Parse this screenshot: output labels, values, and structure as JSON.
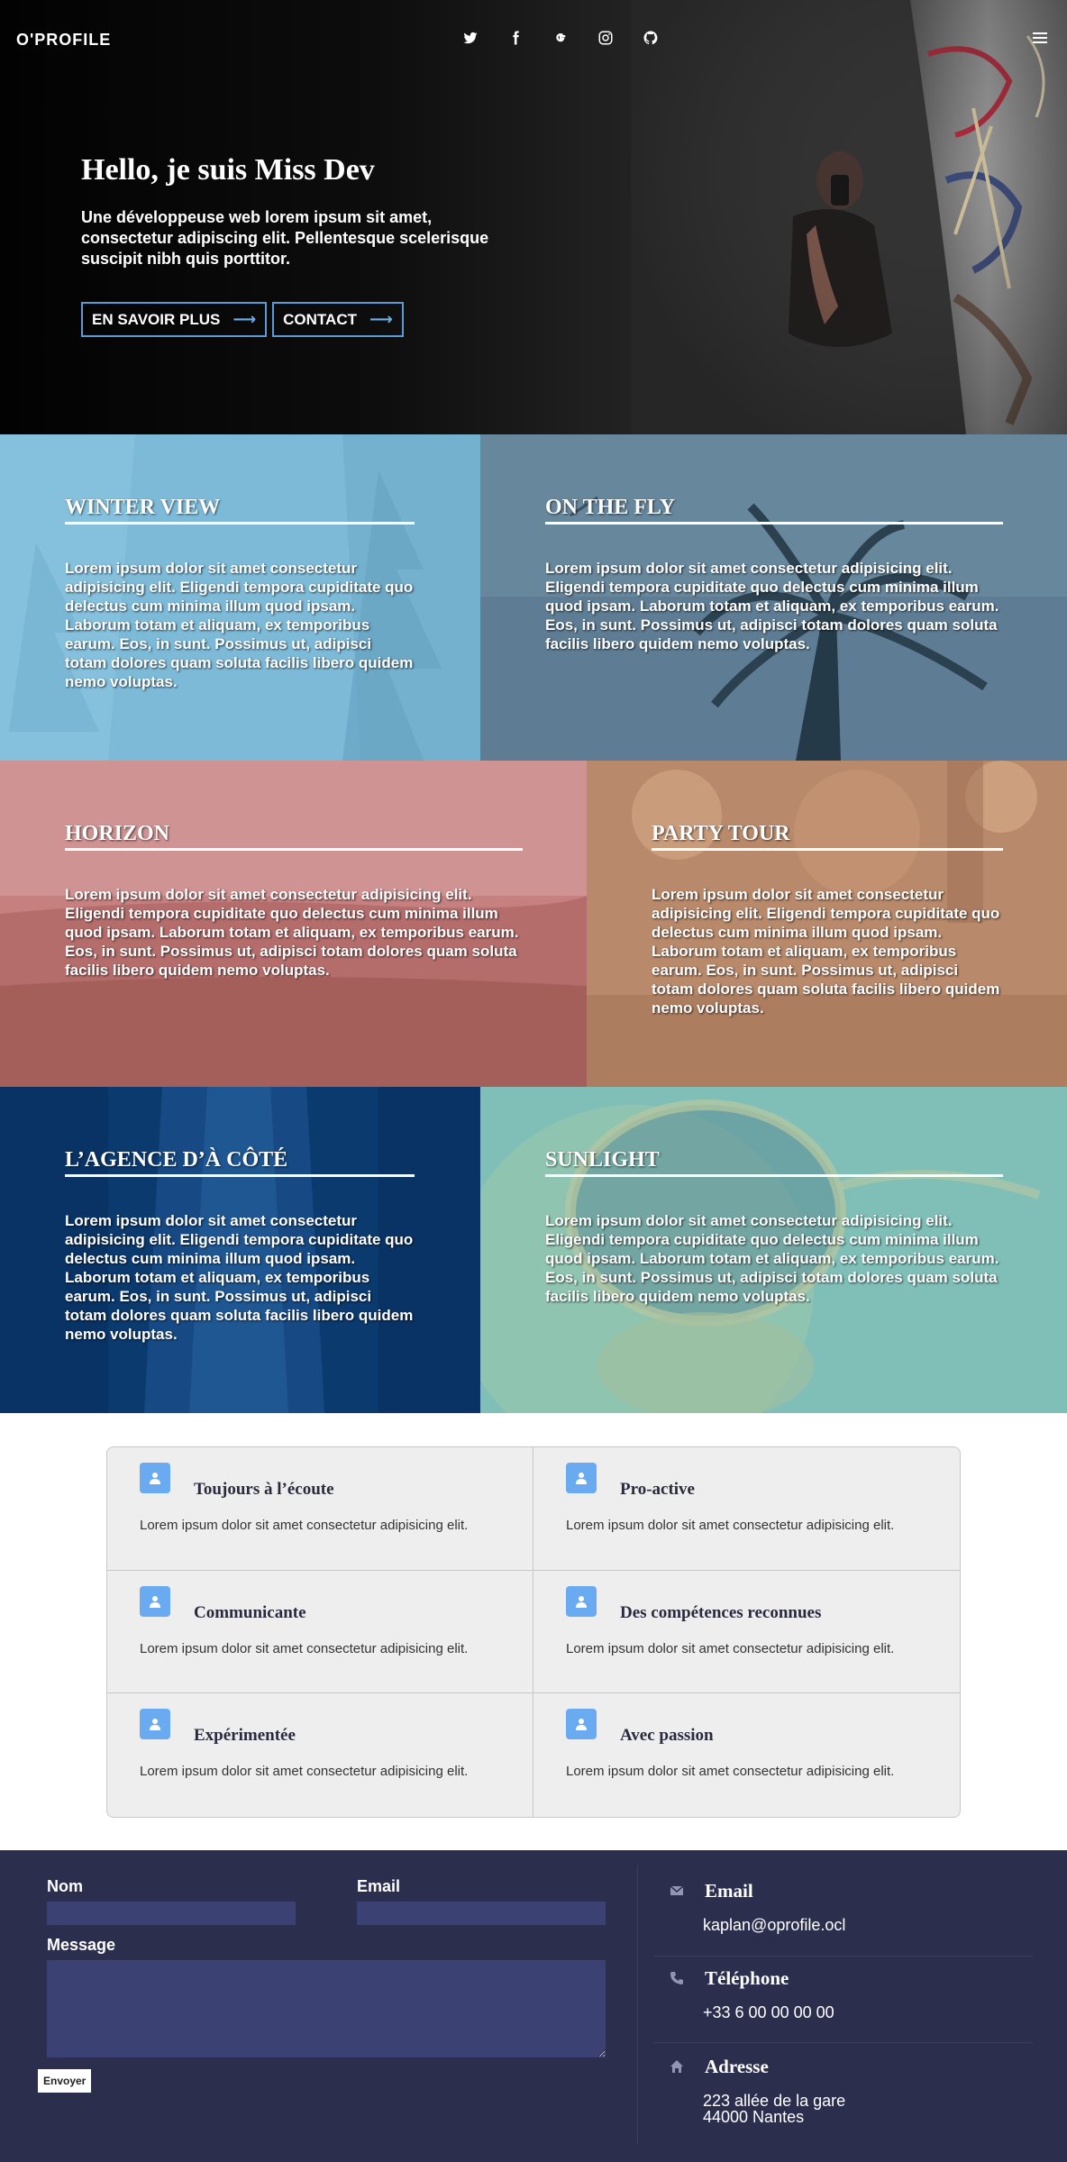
{
  "header": {
    "brand": "O'PROFILE",
    "social_icons": [
      "twitter-icon",
      "facebook-icon",
      "google-icon",
      "instagram-icon",
      "github-icon"
    ],
    "menu_icon": "hamburger-menu-icon"
  },
  "hero": {
    "title": "Hello, je suis Miss Dev",
    "text": "Une développeuse web lorem ipsum sit amet, consectetur adipiscing elit. Pellentesque scelerisque suscipit nibh quis porttitor.",
    "buttons": [
      {
        "label": "EN SAVOIR PLUS",
        "icon": "arrow-right-icon"
      },
      {
        "label": "CONTACT",
        "icon": "arrow-right-icon"
      }
    ]
  },
  "tiles": [
    {
      "title": "WINTER VIEW",
      "text": "Lorem ipsum dolor sit amet consectetur adipisicing elit. Eligendi tempora cupiditate quo delectus cum minima illum quod ipsam. Laborum totam et aliquam, ex temporibus earum. Eos, in sunt. Possimus ut, adipisci totam dolores quam soluta facilis libero quidem nemo voluptas."
    },
    {
      "title": "ON THE FLY",
      "text": "Lorem ipsum dolor sit amet consectetur adipisicing elit. Eligendi tempora cupiditate quo delectus cum minima illum quod ipsam. Laborum totam et aliquam, ex temporibus earum. Eos, in sunt. Possimus ut, adipisci totam dolores quam soluta facilis libero quidem nemo voluptas."
    },
    {
      "title": "HORIZON",
      "text": "Lorem ipsum dolor sit amet consectetur adipisicing elit. Eligendi tempora cupiditate quo delectus cum minima illum quod ipsam. Laborum totam et aliquam, ex temporibus earum. Eos, in sunt. Possimus ut, adipisci totam dolores quam soluta facilis libero quidem nemo voluptas."
    },
    {
      "title": "PARTY TOUR",
      "text": "Lorem ipsum dolor sit amet consectetur adipisicing elit. Eligendi tempora cupiditate quo delectus cum minima illum quod ipsam. Laborum totam et aliquam, ex temporibus earum. Eos, in sunt. Possimus ut, adipisci totam dolores quam soluta facilis libero quidem nemo voluptas."
    },
    {
      "title": "L’AGENCE D’À CÔTÉ",
      "text": "Lorem ipsum dolor sit amet consectetur adipisicing elit. Eligendi tempora cupiditate quo delectus cum minima illum quod ipsam. Laborum totam et aliquam, ex temporibus earum. Eos, in sunt. Possimus ut, adipisci totam dolores quam soluta facilis libero quidem nemo voluptas."
    },
    {
      "title": "SUNLIGHT",
      "text": "Lorem ipsum dolor sit amet consectetur adipisicing elit. Eligendi tempora cupiditate quo delectus cum minima illum quod ipsam. Laborum totam et aliquam, ex temporibus earum. Eos, in sunt. Possimus ut, adipisci totam dolores quam soluta facilis libero quidem nemo voluptas."
    }
  ],
  "features": [
    {
      "title": "Toujours à l’écoute",
      "text": "Lorem ipsum dolor sit amet consectetur adipisicing elit.",
      "icon": "user-icon"
    },
    {
      "title": "Pro-active",
      "text": "Lorem ipsum dolor sit amet consectetur adipisicing elit.",
      "icon": "user-icon"
    },
    {
      "title": "Communicante",
      "text": "Lorem ipsum dolor sit amet consectetur adipisicing elit.",
      "icon": "user-icon"
    },
    {
      "title": "Des compétences reconnues",
      "text": "Lorem ipsum dolor sit amet consectetur adipisicing elit.",
      "icon": "user-icon"
    },
    {
      "title": "Expérimentée",
      "text": "Lorem ipsum dolor sit amet consectetur adipisicing elit.",
      "icon": "user-icon"
    },
    {
      "title": "Avec passion",
      "text": "Lorem ipsum dolor sit amet consectetur adipisicing elit.",
      "icon": "user-icon"
    }
  ],
  "contact_form": {
    "name_label": "Nom",
    "name_value": "",
    "email_label": "Email",
    "email_value": "",
    "message_label": "Message",
    "message_value": "",
    "submit_label": "Envoyer"
  },
  "contact_info": [
    {
      "title": "Email",
      "icon": "envelope-icon",
      "lines": [
        "kaplan@oprofile.ocl"
      ]
    },
    {
      "title": "Téléphone",
      "icon": "phone-icon",
      "lines": [
        "+33 6 00 00 00 00"
      ]
    },
    {
      "title": "Adresse",
      "icon": "home-icon",
      "lines": [
        "223 allée de la gare",
        "44000 Nantes"
      ]
    }
  ],
  "colors": {
    "accent": "#5a9ad6",
    "feature_icon": "#6aaaf0",
    "contact_bg": "#2c2e4e",
    "input_bg": "#3c4173"
  }
}
